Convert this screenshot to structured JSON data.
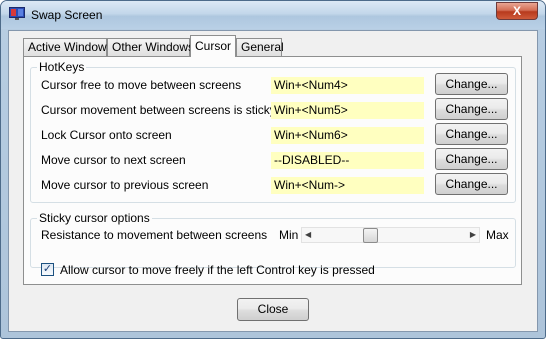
{
  "window": {
    "title": "Swap Screen",
    "close_glyph": "X"
  },
  "tabs": [
    {
      "label": "Active Window"
    },
    {
      "label": "Other Windows"
    },
    {
      "label": "Cursor",
      "active": true
    },
    {
      "label": "General"
    }
  ],
  "hotkeys": {
    "group_title": "HotKeys",
    "rows": [
      {
        "label": "Cursor free to move between screens",
        "value": "Win+<Num4>",
        "button": "Change..."
      },
      {
        "label": "Cursor movement between screens is sticky",
        "value": "Win+<Num5>",
        "button": "Change..."
      },
      {
        "label": "Lock Cursor onto screen",
        "value": "Win+<Num6>",
        "button": "Change..."
      },
      {
        "label": "Move cursor to next screen",
        "value": "--DISABLED--",
        "button": "Change..."
      },
      {
        "label": "Move cursor to previous screen",
        "value": "Win+<Num->",
        "button": "Change..."
      }
    ]
  },
  "sticky": {
    "group_title": "Sticky cursor options",
    "label": "Resistance to movement between screens",
    "min_label": "Min",
    "max_label": "Max",
    "level": 0.35
  },
  "checkbox": {
    "checked": true,
    "glyph": "✓",
    "label": "Allow cursor to move freely if the left Control key is pressed"
  },
  "footer": {
    "close_label": "Close"
  },
  "colors": {
    "hotkey_field": "#ffffc0",
    "title_bar": "#c3d7ea"
  }
}
